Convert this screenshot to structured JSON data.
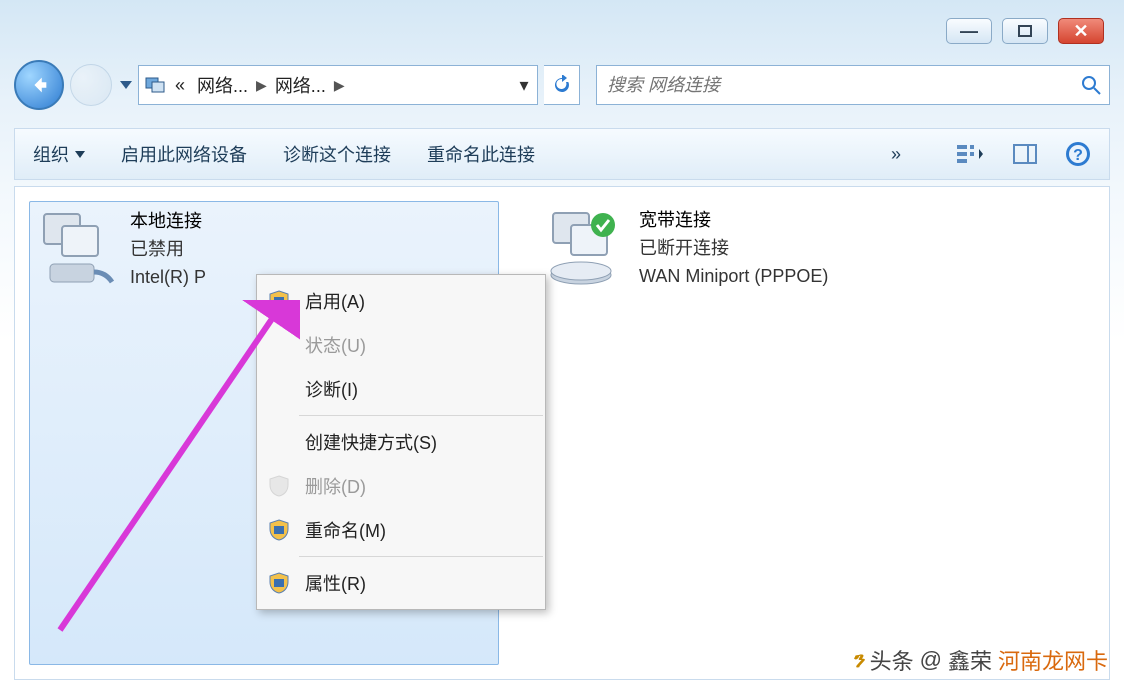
{
  "window": {
    "controls": {
      "min": "–",
      "max": "▢",
      "close": "✕"
    }
  },
  "breadcrumb": {
    "prefix": "«",
    "seg1": "网络...",
    "seg2": "网络...",
    "chev": "▶"
  },
  "search": {
    "placeholder": "搜索 网络连接"
  },
  "toolbar": {
    "organize": "组织",
    "enable_device": "启用此网络设备",
    "diagnose": "诊断这个连接",
    "rename": "重命名此连接",
    "more": "»"
  },
  "connections": [
    {
      "id": "local",
      "title": "本地连接",
      "status": "已禁用",
      "device": "Intel(R) P"
    },
    {
      "id": "broadband",
      "title": "宽带连接",
      "status": "已断开连接",
      "device": "WAN Miniport (PPPOE)"
    }
  ],
  "context_menu": {
    "enable": "启用(A)",
    "status": "状态(U)",
    "diagnose": "诊断(I)",
    "shortcut": "创建快捷方式(S)",
    "delete": "删除(D)",
    "rename": "重命名(M)",
    "properties": "属性(R)"
  },
  "watermark": {
    "prefix": "头条",
    "at": "@",
    "name1": "鑫荣",
    "name2": "河南龙网卡"
  }
}
